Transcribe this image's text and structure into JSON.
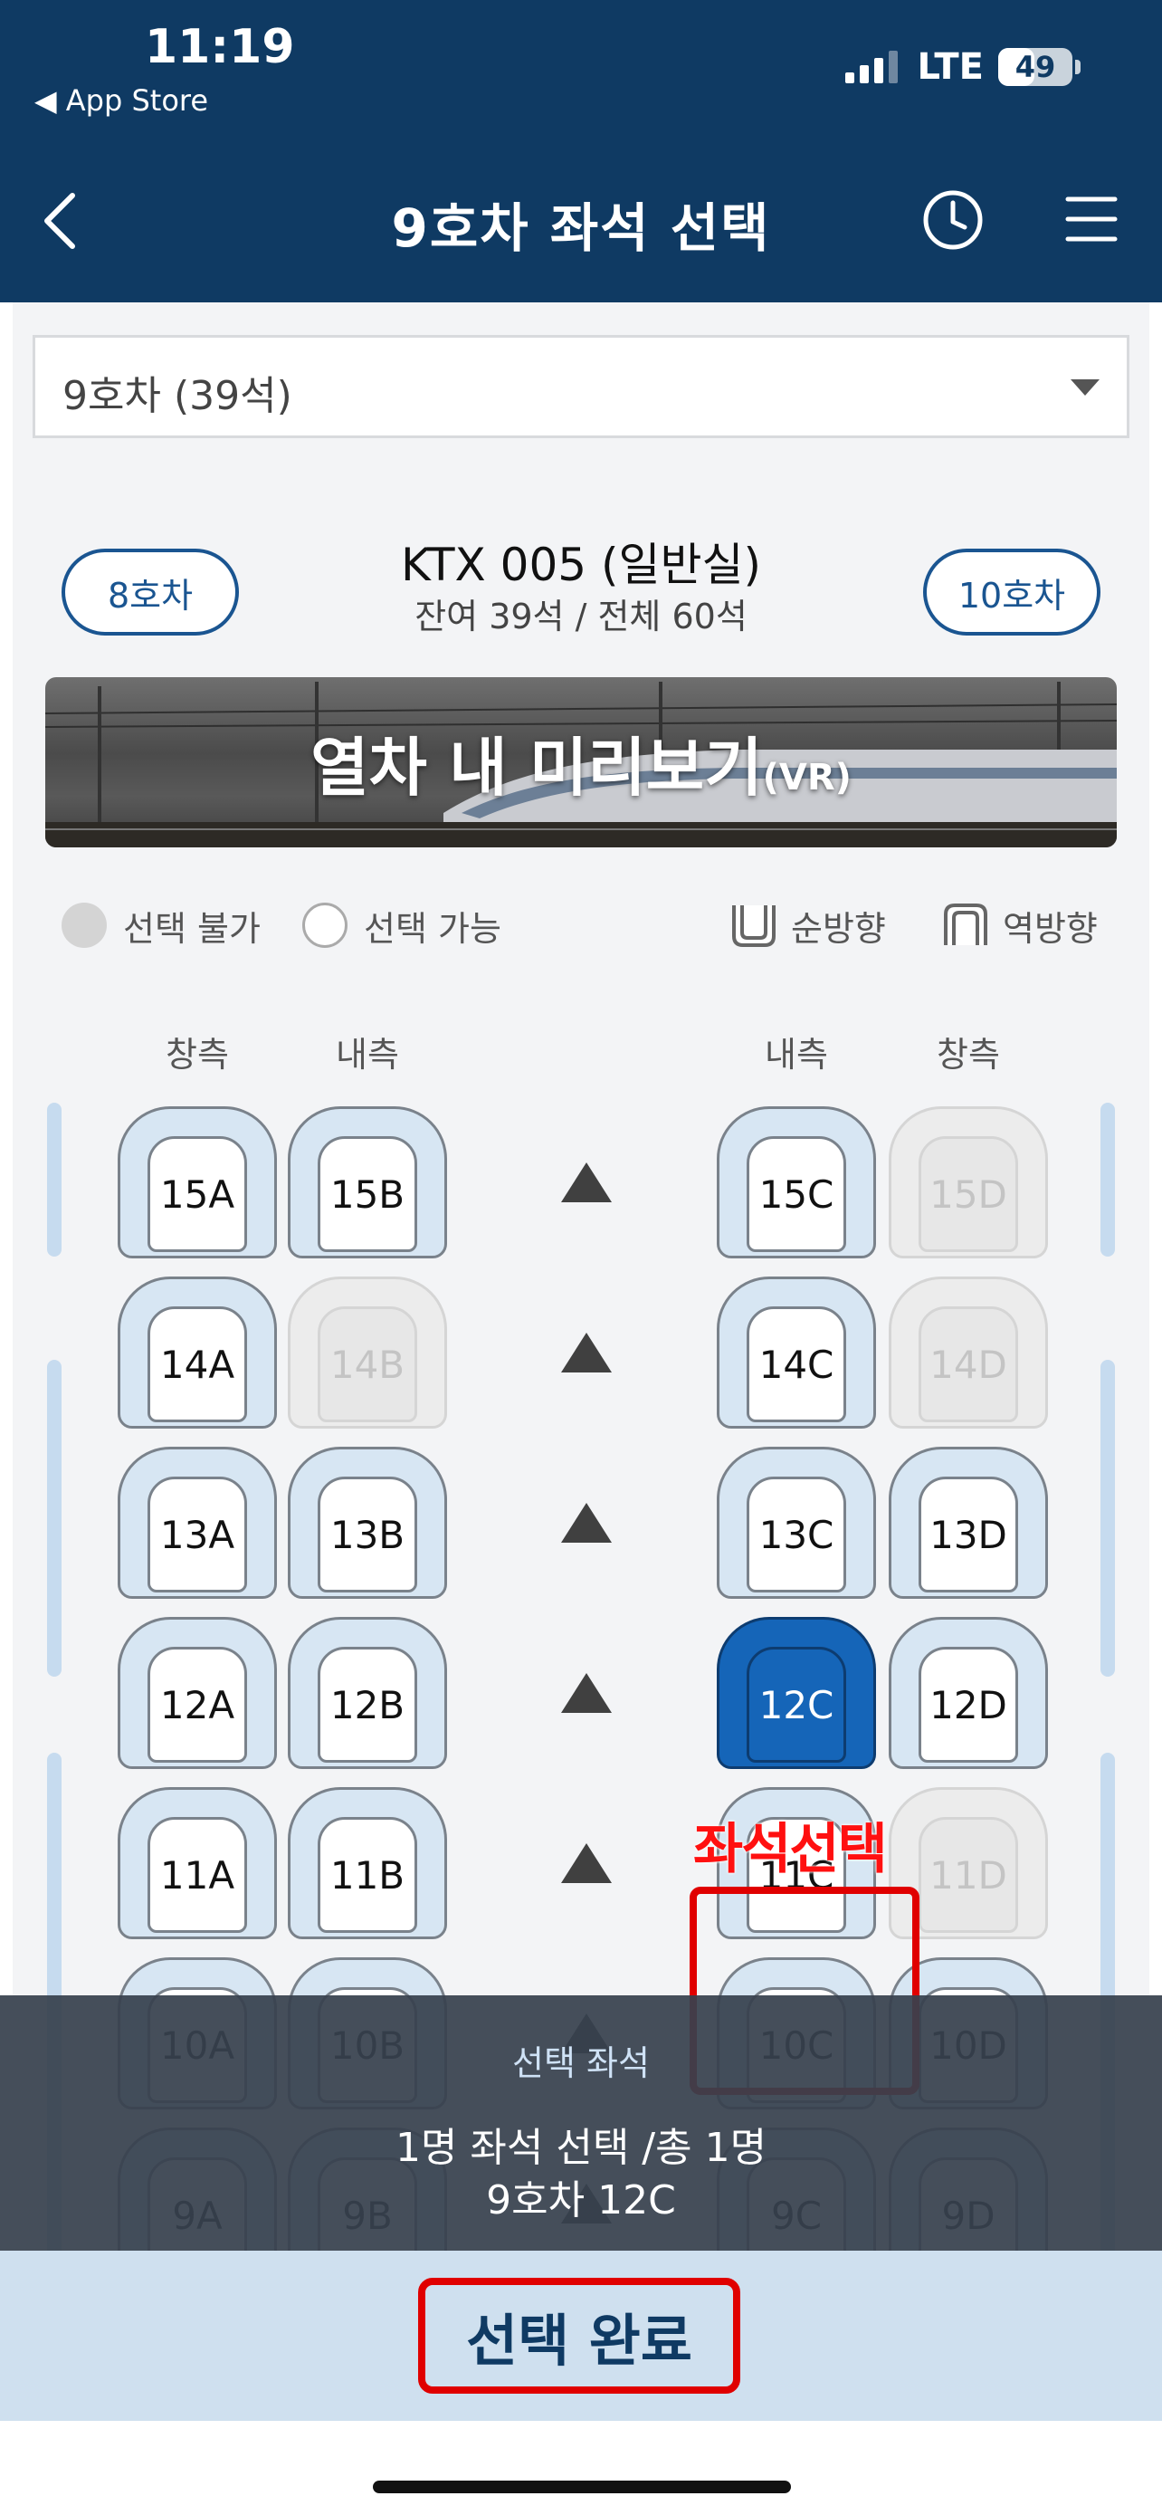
{
  "status_bar": {
    "time": "11:19",
    "back_app": "◀ App Store",
    "network": "LTE",
    "battery": "49",
    "battery_level": 0.49
  },
  "nav": {
    "title": "9호차 좌석 선택",
    "back_icon": "chevron-left-icon",
    "history_icon": "clock-icon",
    "menu_icon": "hamburger-menu-icon"
  },
  "car_select": {
    "value": "9호차 (39석)"
  },
  "car_nav": {
    "prev": "8호차",
    "next": "10호차",
    "train": "KTX 005 (일반실)",
    "remaining": "잔여 39석 / 전체 60석"
  },
  "vr_banner": {
    "text": "열차 내 미리보기",
    "suffix": "(VR)"
  },
  "legend": {
    "unavailable": "선택 불가",
    "available": "선택 가능",
    "forward": "순방향",
    "backward": "역방향"
  },
  "columns": {
    "window_left": "창측",
    "aisle_left": "내측",
    "aisle_right": "내측",
    "window_right": "창측"
  },
  "rows": [
    {
      "A": "15A",
      "B": "15B",
      "C": "15C",
      "D": "15D"
    },
    {
      "A": "14A",
      "B": "14B",
      "C": "14C",
      "D": "14D"
    },
    {
      "A": "13A",
      "B": "13B",
      "C": "13C",
      "D": "13D"
    },
    {
      "A": "12A",
      "B": "12B",
      "C": "12C",
      "D": "12D"
    },
    {
      "A": "11A",
      "B": "11B",
      "C": "11C",
      "D": "11D"
    },
    {
      "A": "10A",
      "B": "10B",
      "C": "10C",
      "D": "10D"
    },
    {
      "A": "9A",
      "B": "9B",
      "C": "9C",
      "D": "9D"
    }
  ],
  "unavailable_seats": [
    "15D",
    "14B",
    "14D",
    "11D"
  ],
  "selected_seat": "12C",
  "annotation": "좌석선택",
  "summary": {
    "label": "선택 좌석",
    "count": "1명 좌석 선택 /총 1명",
    "seat": "9호차 12C"
  },
  "confirm_button": "선택 완료",
  "colors": {
    "header": "#0f3a63",
    "accent": "#1a5591",
    "selected_seat": "#1565b8",
    "annotation": "#e00000"
  }
}
